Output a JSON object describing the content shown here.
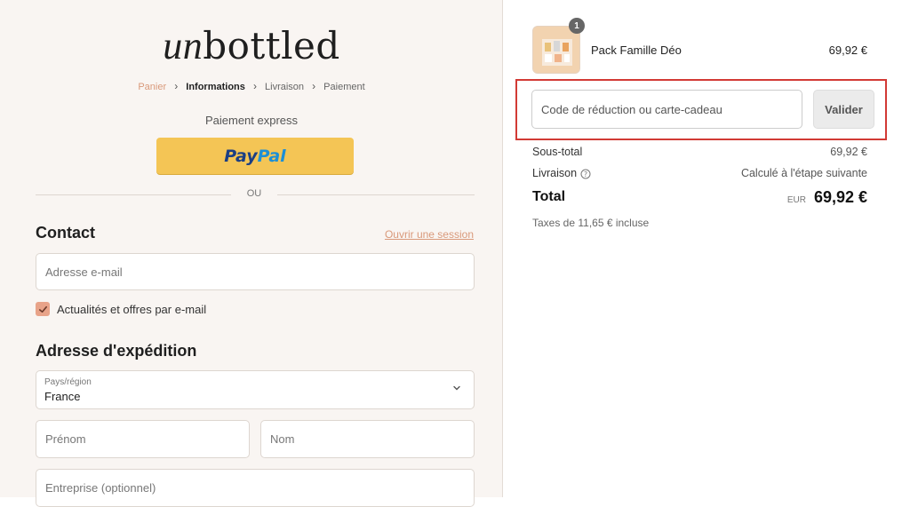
{
  "brand": {
    "logo_script": "un",
    "logo_rest": "bottled"
  },
  "breadcrumb": {
    "items": [
      "Panier",
      "Informations",
      "Livraison",
      "Paiement"
    ]
  },
  "express": {
    "label": "Paiement express",
    "paypal_part1": "Pay",
    "paypal_part2": "Pal",
    "divider_text": "OU"
  },
  "contact": {
    "title": "Contact",
    "login_link": "Ouvrir une session",
    "email_placeholder": "Adresse e-mail",
    "newsletter_label": "Actualités et offres par e-mail",
    "newsletter_checked": true
  },
  "shipping": {
    "title": "Adresse d'expédition",
    "country_label": "Pays/région",
    "country_value": "France",
    "first_name_placeholder": "Prénom",
    "last_name_placeholder": "Nom",
    "company_placeholder": "Entreprise (optionnel)"
  },
  "order": {
    "item_quantity": "1",
    "item_name": "Pack Famille Déo",
    "item_price": "69,92 €",
    "discount_placeholder": "Code de réduction ou carte-cadeau",
    "apply_label": "Valider",
    "subtotal_label": "Sous-total",
    "subtotal_value": "69,92 €",
    "shipping_label": "Livraison",
    "shipping_value": "Calculé à l'étape suivante",
    "total_label": "Total",
    "total_currency": "EUR",
    "total_value": "69,92 €",
    "taxes_note": "Taxes de 11,65 € incluse"
  },
  "colors": {
    "accent": "#d9997a",
    "paypal_yellow": "#f4c555",
    "highlight_red": "#d23a35"
  }
}
